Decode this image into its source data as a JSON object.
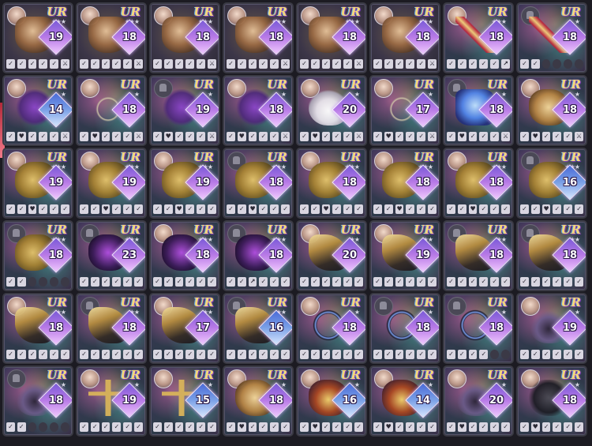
{
  "cards": [
    {
      "rarity": "UR",
      "level": "19",
      "avatar": "portrait",
      "item": "gauntlet",
      "bg": "armor",
      "stars": "★★★",
      "icons": [
        "✓",
        "✓",
        "✓",
        "✓",
        "✓",
        "⚔"
      ],
      "levelColor": "purple"
    },
    {
      "rarity": "UR",
      "level": "18",
      "avatar": "portrait",
      "item": "gauntlet",
      "bg": "armor",
      "stars": "★★★",
      "icons": [
        "✓",
        "✓",
        "✓",
        "✓",
        "✓",
        "⚔"
      ],
      "levelColor": "purple"
    },
    {
      "rarity": "UR",
      "level": "18",
      "avatar": "portrait",
      "item": "gauntlet",
      "bg": "armor",
      "stars": "★★★",
      "icons": [
        "✓",
        "✓",
        "✓",
        "✓",
        "✓",
        "⚔"
      ],
      "levelColor": "purple"
    },
    {
      "rarity": "UR",
      "level": "18",
      "avatar": "portrait",
      "item": "gauntlet",
      "bg": "armor",
      "stars": "★★★",
      "icons": [
        "✓",
        "✓",
        "✓",
        "✓",
        "✓",
        "⚔"
      ],
      "levelColor": "purple"
    },
    {
      "rarity": "UR",
      "level": "18",
      "avatar": "portrait",
      "item": "gauntlet",
      "bg": "armor",
      "stars": "★★★",
      "icons": [
        "✓",
        "✓",
        "✓",
        "✓",
        "✓",
        "⚔"
      ],
      "levelColor": "purple"
    },
    {
      "rarity": "UR",
      "level": "18",
      "avatar": "portrait",
      "item": "gauntlet",
      "bg": "armor",
      "stars": "★★★",
      "icons": [
        "✓",
        "✓",
        "✓",
        "✓",
        "✓",
        "⚔"
      ],
      "levelColor": "purple"
    },
    {
      "rarity": "UR",
      "level": "18",
      "avatar": "portrait",
      "item": "sword",
      "bg": "holo",
      "stars": "★★★",
      "icons": [
        "✓",
        "✓",
        "✓",
        "✓",
        "✓",
        "↗"
      ],
      "levelColor": "purple"
    },
    {
      "rarity": "UR",
      "level": "18",
      "avatar": "lock",
      "item": "sword",
      "bg": "holo",
      "stars": "★",
      "icons": [
        "✓",
        "✓",
        "•",
        "•",
        "•",
        "•"
      ],
      "levelColor": "purple"
    },
    {
      "rarity": "UR",
      "level": "14",
      "avatar": "portrait",
      "item": "bow",
      "bg": "holo",
      "stars": "★",
      "icons": [
        "✓",
        "♥",
        "✓",
        "✓",
        "✓",
        "⚔"
      ],
      "levelColor": "blue"
    },
    {
      "rarity": "UR",
      "level": "18",
      "avatar": "portrait",
      "item": "glasses",
      "bg": "holo",
      "stars": "★",
      "icons": [
        "✓",
        "♥",
        "✓",
        "✓",
        "✓",
        "⚔"
      ],
      "levelColor": "purple"
    },
    {
      "rarity": "UR",
      "level": "19",
      "avatar": "lock",
      "item": "bow",
      "bg": "holo",
      "stars": "★",
      "icons": [
        "✓",
        "♥",
        "✓",
        "✓",
        "✓",
        "⚔"
      ],
      "levelColor": "purple"
    },
    {
      "rarity": "UR",
      "level": "18",
      "avatar": "portrait",
      "item": "bow",
      "bg": "holo",
      "stars": "★",
      "icons": [
        "✓",
        "♥",
        "✓",
        "✓",
        "✓",
        "⚔"
      ],
      "levelColor": "purple"
    },
    {
      "rarity": "UR",
      "level": "20",
      "avatar": "portrait",
      "item": "bunny",
      "bg": "holo",
      "stars": "★",
      "icons": [
        "✓",
        "♥",
        "✓",
        "✓",
        "✓",
        "⚔"
      ],
      "levelColor": "purple"
    },
    {
      "rarity": "UR",
      "level": "17",
      "avatar": "portrait",
      "item": "glasses",
      "bg": "holo",
      "stars": "★",
      "icons": [
        "✓",
        "♥",
        "✓",
        "✓",
        "✓",
        "⚔"
      ],
      "levelColor": "purple"
    },
    {
      "rarity": "UR",
      "level": "18",
      "avatar": "lock",
      "item": "crystal",
      "bg": "holo",
      "stars": "★",
      "icons": [
        "✓",
        "♥",
        "✓",
        "✓",
        "✓",
        "⚔"
      ],
      "levelColor": "purple"
    },
    {
      "rarity": "UR",
      "level": "18",
      "avatar": "portrait",
      "item": "ring",
      "bg": "holo",
      "stars": "★",
      "icons": [
        "✓",
        "♥",
        "✓",
        "✓",
        "✓",
        "⚔"
      ],
      "levelColor": "purple"
    },
    {
      "rarity": "UR",
      "level": "19",
      "avatar": "portrait",
      "item": "gold",
      "bg": "holo",
      "stars": "★★★",
      "icons": [
        "✓",
        "✓",
        "♥",
        "✓",
        "✓",
        "✓"
      ],
      "levelColor": "purple"
    },
    {
      "rarity": "UR",
      "level": "19",
      "avatar": "portrait",
      "item": "gold",
      "bg": "holo",
      "stars": "★★★",
      "icons": [
        "✓",
        "✓",
        "♥",
        "✓",
        "✓",
        "✓"
      ],
      "levelColor": "purple"
    },
    {
      "rarity": "UR",
      "level": "19",
      "avatar": "portrait",
      "item": "gold",
      "bg": "holo",
      "stars": "★★★",
      "icons": [
        "✓",
        "✓",
        "♥",
        "✓",
        "✓",
        "✓"
      ],
      "levelColor": "purple"
    },
    {
      "rarity": "UR",
      "level": "18",
      "avatar": "lock",
      "item": "gold",
      "bg": "holo",
      "stars": "★★★",
      "icons": [
        "✓",
        "✓",
        "♥",
        "✓",
        "✓",
        "✓"
      ],
      "levelColor": "purple"
    },
    {
      "rarity": "UR",
      "level": "18",
      "avatar": "portrait",
      "item": "gold",
      "bg": "holo",
      "stars": "★★★",
      "icons": [
        "✓",
        "✓",
        "♥",
        "✓",
        "✓",
        "✓"
      ],
      "levelColor": "purple"
    },
    {
      "rarity": "UR",
      "level": "18",
      "avatar": "portrait",
      "item": "gold",
      "bg": "holo",
      "stars": "★★★",
      "icons": [
        "✓",
        "✓",
        "♥",
        "✓",
        "✓",
        "✓"
      ],
      "levelColor": "purple"
    },
    {
      "rarity": "UR",
      "level": "18",
      "avatar": "portrait",
      "item": "gold",
      "bg": "holo",
      "stars": "★★★",
      "icons": [
        "✓",
        "✓",
        "♥",
        "✓",
        "✓",
        "✓"
      ],
      "levelColor": "purple"
    },
    {
      "rarity": "UR",
      "level": "16",
      "avatar": "lock",
      "item": "gold",
      "bg": "holo",
      "stars": "★★★",
      "icons": [
        "✓",
        "✓",
        "♥",
        "✓",
        "✓",
        "✓"
      ],
      "levelColor": "blue"
    },
    {
      "rarity": "UR",
      "level": "18",
      "avatar": "lock",
      "item": "gold",
      "bg": "holo",
      "stars": "★★★",
      "icons": [
        "✓",
        "✓",
        "•",
        "•",
        "•",
        "•"
      ],
      "levelColor": "purple"
    },
    {
      "rarity": "UR",
      "level": "23",
      "avatar": "lock",
      "item": "shadow",
      "bg": "holo",
      "stars": "★★★",
      "icons": [
        "✓",
        "✓",
        "✓",
        "✓",
        "✓",
        "✓"
      ],
      "levelColor": "purple"
    },
    {
      "rarity": "UR",
      "level": "18",
      "avatar": "portrait",
      "item": "shadow",
      "bg": "holo",
      "stars": "★★★",
      "icons": [
        "✓",
        "✓",
        "✓",
        "✓",
        "✓",
        "✓"
      ],
      "levelColor": "purple"
    },
    {
      "rarity": "UR",
      "level": "18",
      "avatar": "lock",
      "item": "shadow",
      "bg": "holo",
      "stars": "★★★",
      "icons": [
        "✓",
        "✓",
        "↗",
        "✓",
        "✓",
        "✓"
      ],
      "levelColor": "purple"
    },
    {
      "rarity": "UR",
      "level": "20",
      "avatar": "portrait",
      "item": "horn",
      "bg": "holo",
      "stars": "★★",
      "icons": [
        "✓",
        "✓",
        "✓",
        "✓",
        "✓",
        "✓"
      ],
      "levelColor": "purple"
    },
    {
      "rarity": "UR",
      "level": "19",
      "avatar": "portrait",
      "item": "horn",
      "bg": "holo",
      "stars": "★★",
      "icons": [
        "✓",
        "✓",
        "✓",
        "✓",
        "✓",
        "✓"
      ],
      "levelColor": "purple"
    },
    {
      "rarity": "UR",
      "level": "18",
      "avatar": "lock",
      "item": "horn",
      "bg": "holo",
      "stars": "★★",
      "icons": [
        "✓",
        "✓",
        "✓",
        "✓",
        "✓",
        "✓"
      ],
      "levelColor": "purple"
    },
    {
      "rarity": "UR",
      "level": "18",
      "avatar": "lock",
      "item": "horn",
      "bg": "holo",
      "stars": "★★",
      "icons": [
        "✓",
        "✓",
        "✓",
        "✓",
        "✓",
        "✓"
      ],
      "levelColor": "purple"
    },
    {
      "rarity": "UR",
      "level": "18",
      "avatar": "portrait",
      "item": "horn",
      "bg": "holo",
      "stars": "★★",
      "icons": [
        "✓",
        "✓",
        "✓",
        "✓",
        "✓",
        "✓"
      ],
      "levelColor": "purple"
    },
    {
      "rarity": "UR",
      "level": "18",
      "avatar": "lock",
      "item": "horn",
      "bg": "holo",
      "stars": "★★",
      "icons": [
        "✓",
        "✓",
        "✓",
        "✓",
        "✓",
        "✓"
      ],
      "levelColor": "purple"
    },
    {
      "rarity": "UR",
      "level": "17",
      "avatar": "portrait",
      "item": "horn",
      "bg": "holo",
      "stars": "★★",
      "icons": [
        "✓",
        "✓",
        "✓",
        "✓",
        "✓",
        "✓"
      ],
      "levelColor": "purple"
    },
    {
      "rarity": "UR",
      "level": "16",
      "avatar": "lock",
      "item": "horn",
      "bg": "holo",
      "stars": "★★",
      "icons": [
        "✓",
        "✓",
        "✓",
        "✓",
        "✓",
        "✓"
      ],
      "levelColor": "blue"
    },
    {
      "rarity": "UR",
      "level": "18",
      "avatar": "portrait",
      "item": "choker",
      "bg": "holo",
      "stars": "★",
      "icons": [
        "✓",
        "✓",
        "✓",
        "✓",
        "✓",
        "✓"
      ],
      "levelColor": "purple"
    },
    {
      "rarity": "UR",
      "level": "18",
      "avatar": "lock",
      "item": "choker",
      "bg": "holo",
      "stars": "★",
      "icons": [
        "✓",
        "✓",
        "✓",
        "✓",
        "✓",
        "✓"
      ],
      "levelColor": "purple"
    },
    {
      "rarity": "UR",
      "level": "18",
      "avatar": "lock",
      "item": "choker",
      "bg": "holo",
      "stars": "★",
      "icons": [
        "✓",
        "✓",
        "✓",
        "✓",
        "•",
        "•"
      ],
      "levelColor": "purple"
    },
    {
      "rarity": "UR",
      "level": "19",
      "avatar": "portrait",
      "item": "rosary",
      "bg": "holo",
      "stars": "★",
      "icons": [
        "✓",
        "✓",
        "✓",
        "✓",
        "✓",
        "✓"
      ],
      "levelColor": "purple"
    },
    {
      "rarity": "UR",
      "level": "18",
      "avatar": "lock",
      "item": "rosary",
      "bg": "holo",
      "stars": "★",
      "icons": [
        "✓",
        "✓",
        "•",
        "•",
        "•",
        "•"
      ],
      "levelColor": "purple"
    },
    {
      "rarity": "UR",
      "level": "19",
      "avatar": "portrait",
      "item": "cross",
      "bg": "holo",
      "stars": "★",
      "icons": [
        "✓",
        "✓",
        "✓",
        "✓",
        "✓",
        "✓"
      ],
      "levelColor": "purple"
    },
    {
      "rarity": "UR",
      "level": "15",
      "avatar": "portrait",
      "item": "cross",
      "bg": "holo",
      "stars": "★",
      "icons": [
        "✓",
        "✓",
        "✓",
        "✓",
        "✓",
        "✓"
      ],
      "levelColor": "blue"
    },
    {
      "rarity": "UR",
      "level": "18",
      "avatar": "portrait",
      "item": "ring",
      "bg": "holo",
      "stars": "★",
      "icons": [
        "✓",
        "♥",
        "✓",
        "✓",
        "✓",
        "✓"
      ],
      "levelColor": "purple"
    },
    {
      "rarity": "UR",
      "level": "16",
      "avatar": "portrait",
      "item": "crown",
      "bg": "holo",
      "stars": "★",
      "icons": [
        "✓",
        "♥",
        "✓",
        "✓",
        "✓",
        "✓"
      ],
      "levelColor": "blue"
    },
    {
      "rarity": "UR",
      "level": "14",
      "avatar": "portrait",
      "item": "crown",
      "bg": "holo",
      "stars": "★",
      "icons": [
        "✓",
        "♥",
        "✓",
        "✓",
        "✓",
        "✓"
      ],
      "levelColor": "blue"
    },
    {
      "rarity": "UR",
      "level": "20",
      "avatar": "portrait",
      "item": "rosary",
      "bg": "holo",
      "stars": "★",
      "icons": [
        "✓",
        "♥",
        "✓",
        "✓",
        "✓",
        "✓"
      ],
      "levelColor": "purple"
    },
    {
      "rarity": "UR",
      "level": "18",
      "avatar": "portrait",
      "item": "mask",
      "bg": "holo",
      "stars": "★",
      "icons": [
        "✓",
        "♥",
        "✓",
        "✓",
        "✓",
        "✓"
      ],
      "levelColor": "purple"
    }
  ]
}
